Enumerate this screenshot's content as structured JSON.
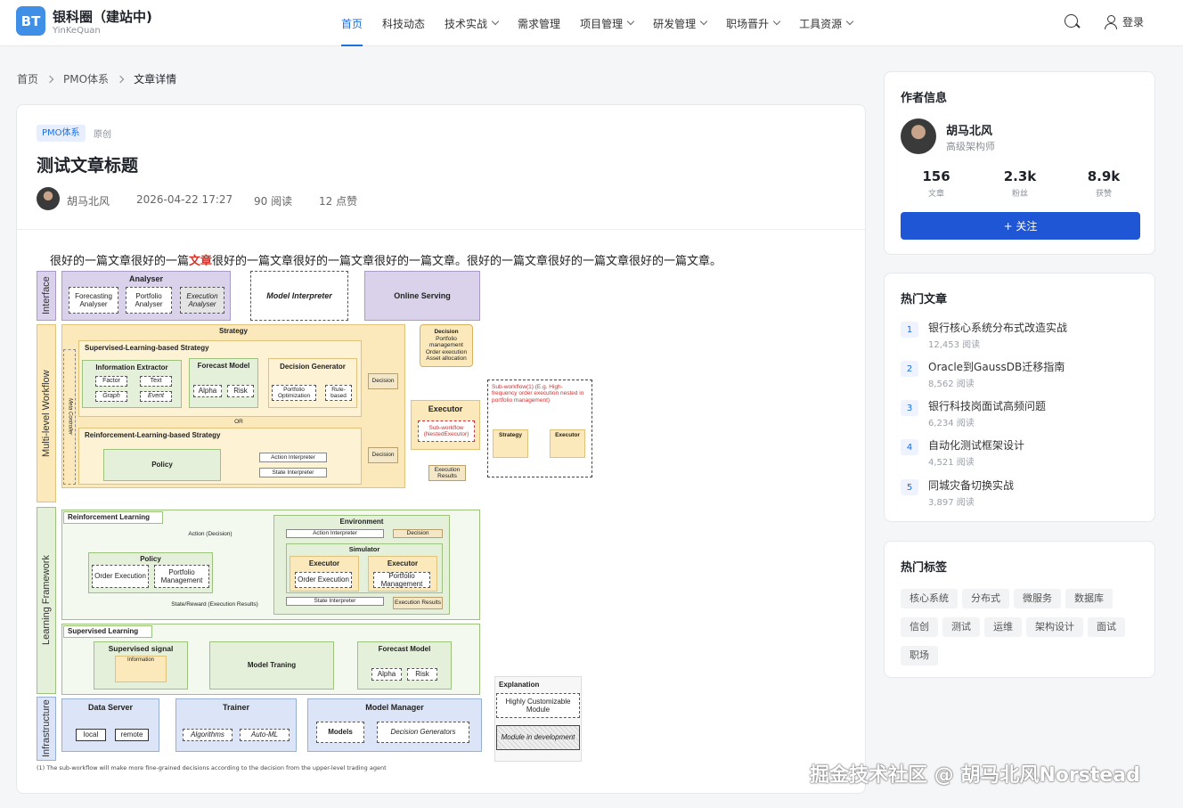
{
  "header": {
    "logo_text": "BT",
    "site_name": "银科圈（建站中)",
    "site_sub": "YinKeQuan",
    "nav": [
      {
        "label": "首页",
        "dropdown": false,
        "active": true
      },
      {
        "label": "科技动态",
        "dropdown": false
      },
      {
        "label": "技术实战",
        "dropdown": true
      },
      {
        "label": "需求管理",
        "dropdown": false
      },
      {
        "label": "项目管理",
        "dropdown": true
      },
      {
        "label": "研发管理",
        "dropdown": true
      },
      {
        "label": "职场晋升",
        "dropdown": true
      },
      {
        "label": "工具资源",
        "dropdown": true
      }
    ],
    "login_label": "登录"
  },
  "breadcrumb": [
    "首页",
    "PMO体系",
    "文章详情"
  ],
  "article": {
    "category": "PMO体系",
    "original_label": "原创",
    "title": "测试文章标题",
    "author": "胡马北风",
    "date": "2026-04-22 17:27",
    "reads": "90 阅读",
    "likes": "12 点赞",
    "lead_before": "很好的一篇文章很好的一篇",
    "lead_highlight": "文章",
    "lead_after": "很好的一篇文章很好的一篇文章很好的一篇文章。很好的一篇文章很好的一篇文章很好的一篇文章。"
  },
  "diagram": {
    "layers": [
      "Interface",
      "Multi-level Workflow",
      "Learning Framework",
      "Infrastructure"
    ],
    "analyser": "Analyser",
    "forecasting_analyser": "Forecasting Analyser",
    "portfolio_analyser": "Portfolio Analyser",
    "execution_analyser": "Execution Analyser",
    "model_interpreter": "Model Interpreter",
    "online_serving": "Online Serving",
    "strategy": "Strategy",
    "supervised_strategy": "Supervised-Learning-based Strategy",
    "information_extractor": "Information Extractor",
    "factor": "Factor",
    "text": "Text",
    "graph": "Graph",
    "event": "Event",
    "forecast_model": "Forecast Model",
    "alpha": "Alpha",
    "risk": "Risk",
    "decision_generator": "Decision Generator",
    "portfolio_optimization": "Portfolio Optimization",
    "rule_based": "Rule-based",
    "decision": "Decision",
    "or": "OR",
    "rl_strategy": "Reinforcement-Learning-based Strategy",
    "policy": "Policy",
    "action_interpreter": "Action Interpreter",
    "state_interpreter": "State Interpreter",
    "meta_controller": "Meta Controller",
    "decision_box": [
      "Decision",
      "Portfolio management",
      "Order execution",
      "Asset allocation"
    ],
    "executor": "Executor",
    "sub_workflow": "Sub-workflow (NestedExecutor)",
    "execution_results": "Execution Results",
    "subwf_note": "Sub-workflow(1) (E.g. High-frequency order execution nested in portfolio management)",
    "strategy_small": "Strategy",
    "executor_small": "Executor",
    "ellipsis": "...",
    "rl_title": "Reinforcement Learning",
    "action_decision": "Action (Decision)",
    "environment": "Environment",
    "simulator": "Simulator",
    "order_execution": "Order Execution",
    "portfolio_management": "Portfolio Management",
    "state_reward": "State/Reward (Execution Results)",
    "supervised_learning": "Supervised Learning",
    "supervised_signal": "Supervised signal",
    "information": "Information",
    "model_training": "Model Traning",
    "explanation": "Explanation",
    "highly_customizable": "Highly Customizable Module",
    "module_in_dev": "Module in development",
    "data_server": "Data Server",
    "local": "local",
    "remote": "remote",
    "trainer": "Trainer",
    "algorithms": "Algorithms",
    "auto_ml": "Auto-ML",
    "model_manager": "Model Manager",
    "models": "Models",
    "decision_generators": "Decision Generators",
    "footnote": "(1)  The sub-workflow will make more fine-grained decisions according to the decision from the upper-level trading agent"
  },
  "watermark": "掘金技术社区 @ 胡马北风Norstead",
  "sidebar": {
    "author_card": {
      "title": "作者信息",
      "name": "胡马北风",
      "role": "高级架构师",
      "stats": [
        {
          "value": "156",
          "label": "文章"
        },
        {
          "value": "2.3k",
          "label": "粉丝"
        },
        {
          "value": "8.9k",
          "label": "获赞"
        }
      ],
      "follow_label": "+ 关注"
    },
    "hot_articles": {
      "title": "热门文章",
      "items": [
        {
          "rank": "1",
          "title": "银行核心系统分布式改造实战",
          "views": "12,453 阅读"
        },
        {
          "rank": "2",
          "title": "Oracle到GaussDB迁移指南",
          "views": "8,562 阅读"
        },
        {
          "rank": "3",
          "title": "银行科技岗面试高频问题",
          "views": "6,234 阅读"
        },
        {
          "rank": "4",
          "title": "自动化测试框架设计",
          "views": "4,521 阅读"
        },
        {
          "rank": "5",
          "title": "同城灾备切换实战",
          "views": "3,897 阅读"
        }
      ]
    },
    "hot_tags": {
      "title": "热门标签",
      "tags": [
        "核心系统",
        "分布式",
        "微服务",
        "数据库",
        "信创",
        "测试",
        "运维",
        "架构设计",
        "面试",
        "职场"
      ]
    }
  }
}
